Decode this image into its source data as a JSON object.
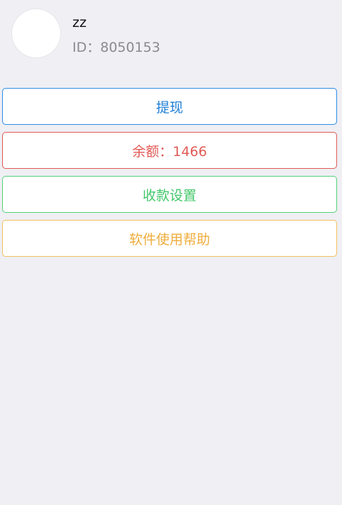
{
  "profile": {
    "username": "zz",
    "id_text": "ID：8050153"
  },
  "actions": {
    "withdraw_label": "提现",
    "balance_label": "余额：1466",
    "payment_settings_label": "收款设置",
    "help_label": "软件使用帮助"
  },
  "colors": {
    "background": "#efeff4",
    "blue": "#1f7fd6",
    "red": "#e05a55",
    "green": "#43c76a",
    "orange": "#efad3d"
  }
}
